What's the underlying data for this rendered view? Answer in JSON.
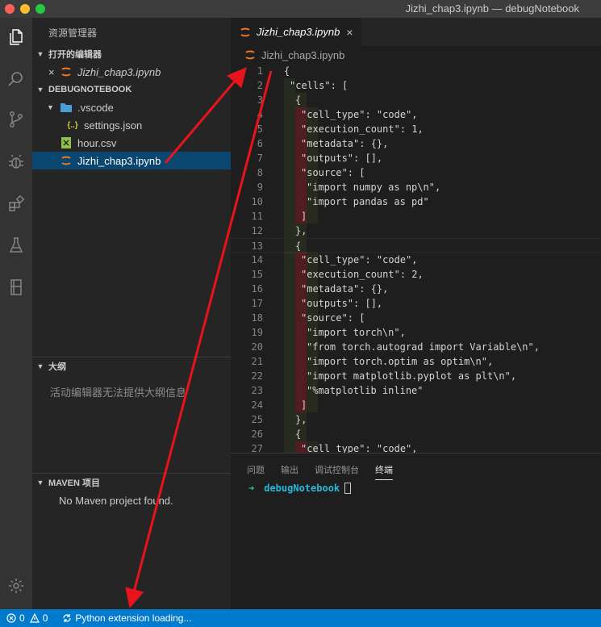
{
  "window": {
    "title": "Jizhi_chap3.ipynb — debugNotebook"
  },
  "activity_bar": {
    "icons": [
      "files-icon",
      "search-icon",
      "source-control-icon",
      "debug-icon",
      "extensions-icon",
      "testing-icon",
      "notebook-icon",
      "gear-icon"
    ]
  },
  "sidebar": {
    "title": "资源管理器",
    "open_editors": {
      "header": "打开的编辑器",
      "items": [
        {
          "label": "Jizhi_chap3.ipynb"
        }
      ]
    },
    "workspace": {
      "header": "DEBUGNOTEBOOK",
      "items": [
        {
          "label": ".vscode",
          "type": "folder"
        },
        {
          "label": "settings.json",
          "type": "json"
        },
        {
          "label": "hour.csv",
          "type": "csv"
        },
        {
          "label": "Jizhi_chap3.ipynb",
          "type": "notebook"
        }
      ]
    },
    "outline": {
      "header": "大纲",
      "message": "活动编辑器无法提供大纲信息"
    },
    "maven": {
      "header": "MAVEN 项目",
      "message": "No Maven project found."
    }
  },
  "editor": {
    "tab_label": "Jizhi_chap3.ipynb",
    "breadcrumb": "Jizhi_chap3.ipynb",
    "lines": [
      {
        "n": "1",
        "text": "{"
      },
      {
        "n": "2",
        "text": "\"cells\": ["
      },
      {
        "n": "3",
        "text": "{"
      },
      {
        "n": "4",
        "text": "\"cell_type\": \"code\","
      },
      {
        "n": "5",
        "text": "\"execution_count\": 1,"
      },
      {
        "n": "6",
        "text": "\"metadata\": {},"
      },
      {
        "n": "7",
        "text": "\"outputs\": [],"
      },
      {
        "n": "8",
        "text": "\"source\": ["
      },
      {
        "n": "9",
        "text": "\"import numpy as np\\n\","
      },
      {
        "n": "10",
        "text": "\"import pandas as pd\""
      },
      {
        "n": "11",
        "text": "]"
      },
      {
        "n": "12",
        "text": "},"
      },
      {
        "n": "13",
        "text": "{"
      },
      {
        "n": "14",
        "text": "\"cell_type\": \"code\","
      },
      {
        "n": "15",
        "text": "\"execution_count\": 2,"
      },
      {
        "n": "16",
        "text": "\"metadata\": {},"
      },
      {
        "n": "17",
        "text": "\"outputs\": [],"
      },
      {
        "n": "18",
        "text": "\"source\": ["
      },
      {
        "n": "19",
        "text": "\"import torch\\n\","
      },
      {
        "n": "20",
        "text": "\"from torch.autograd import Variable\\n\","
      },
      {
        "n": "21",
        "text": "\"import torch.optim as optim\\n\","
      },
      {
        "n": "22",
        "text": "\"import matplotlib.pyplot as plt\\n\","
      },
      {
        "n": "23",
        "text": "\"%matplotlib inline\""
      },
      {
        "n": "24",
        "text": "]"
      },
      {
        "n": "25",
        "text": "},"
      },
      {
        "n": "26",
        "text": "{"
      },
      {
        "n": "27",
        "text": "\"cell_type\": \"code\","
      }
    ]
  },
  "panel": {
    "tabs": [
      "问题",
      "输出",
      "调试控制台",
      "终端"
    ],
    "active_tab": "终端",
    "terminal": {
      "prompt_arrow": "➜",
      "directory": "debugNotebook"
    }
  },
  "statusbar": {
    "errors": "0",
    "warnings": "0",
    "python_status": "Python extension loading..."
  },
  "colors": {
    "accent": "#007acc",
    "selection": "#094771",
    "arrow": "#e8141b"
  }
}
